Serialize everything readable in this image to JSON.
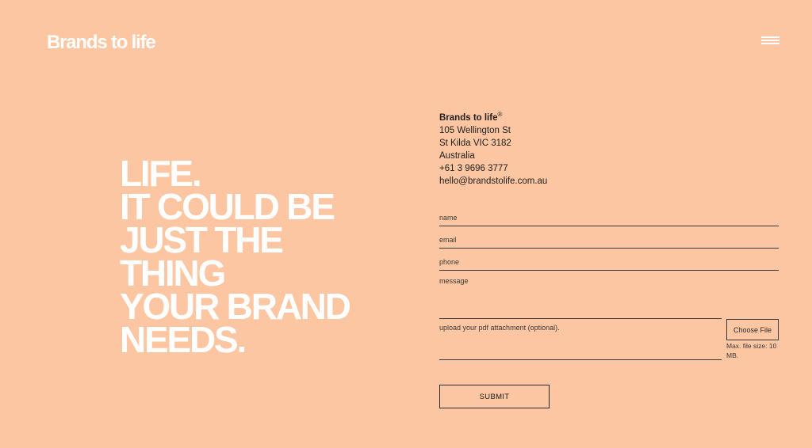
{
  "header": {
    "logo_text": "Brands to life",
    "menu_icon": "hamburger-menu-icon"
  },
  "hero": {
    "lines": [
      "LIFE.",
      "IT COULD BE",
      "JUST THE",
      "THING",
      "YOUR BRAND",
      "NEEDS."
    ]
  },
  "contact": {
    "company": "Brands to life",
    "registered_mark": "®",
    "street": "105 Wellington St",
    "city": "St Kilda VIC 3182",
    "country": "Australia",
    "phone": "+61 3 9696 3777",
    "email": "hello@brandstolife.com.au"
  },
  "form": {
    "name_placeholder": "name",
    "email_placeholder": "email",
    "phone_placeholder": "phone",
    "message_placeholder": "message",
    "upload_label": "upload your pdf attachment (optional).",
    "choose_file_label": "Choose File",
    "file_note": "Max. file size: 10 MB.",
    "submit_label": "SUBMIT"
  },
  "colors": {
    "background": "#FDC6A2",
    "headline": "#FFFFFF",
    "text": "#1A1A1A"
  }
}
